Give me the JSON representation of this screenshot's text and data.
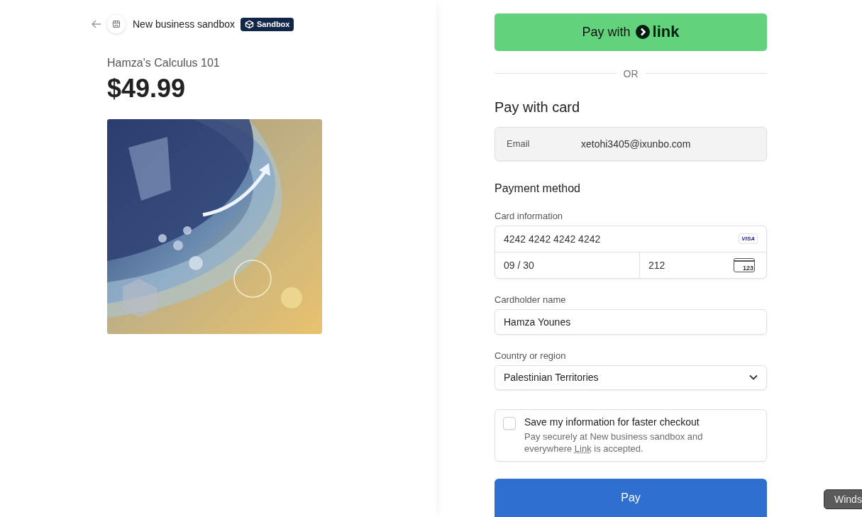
{
  "header": {
    "business_name": "New business sandbox",
    "badge": "Sandbox"
  },
  "product": {
    "name": "Hamza's Calculus 101",
    "price": "$49.99"
  },
  "link_button": {
    "label": "Pay with",
    "brand": "link"
  },
  "divider": "OR",
  "card_section": {
    "title": "Pay with card",
    "email": {
      "label": "Email",
      "value": "xetohi3405@ixunbo.com"
    },
    "payment_title": "Payment method",
    "card_label": "Card information",
    "card_number": "4242 4242 4242 4242",
    "card_brand": "VISA",
    "expiry": "09 / 30",
    "cvc": "212",
    "cvc_icon_text": "123",
    "name_label": "Cardholder name",
    "name_value": "Hamza Younes",
    "country_label": "Country or region",
    "country_value": "Palestinian Territories"
  },
  "save_info": {
    "checked": false,
    "title": "Save my information for faster checkout",
    "note_before": "Pay securely at New business sandbox and everywhere ",
    "note_link": "Link",
    "note_after": " is accepted."
  },
  "pay_button": "Pay",
  "tooltip": "Winds"
}
